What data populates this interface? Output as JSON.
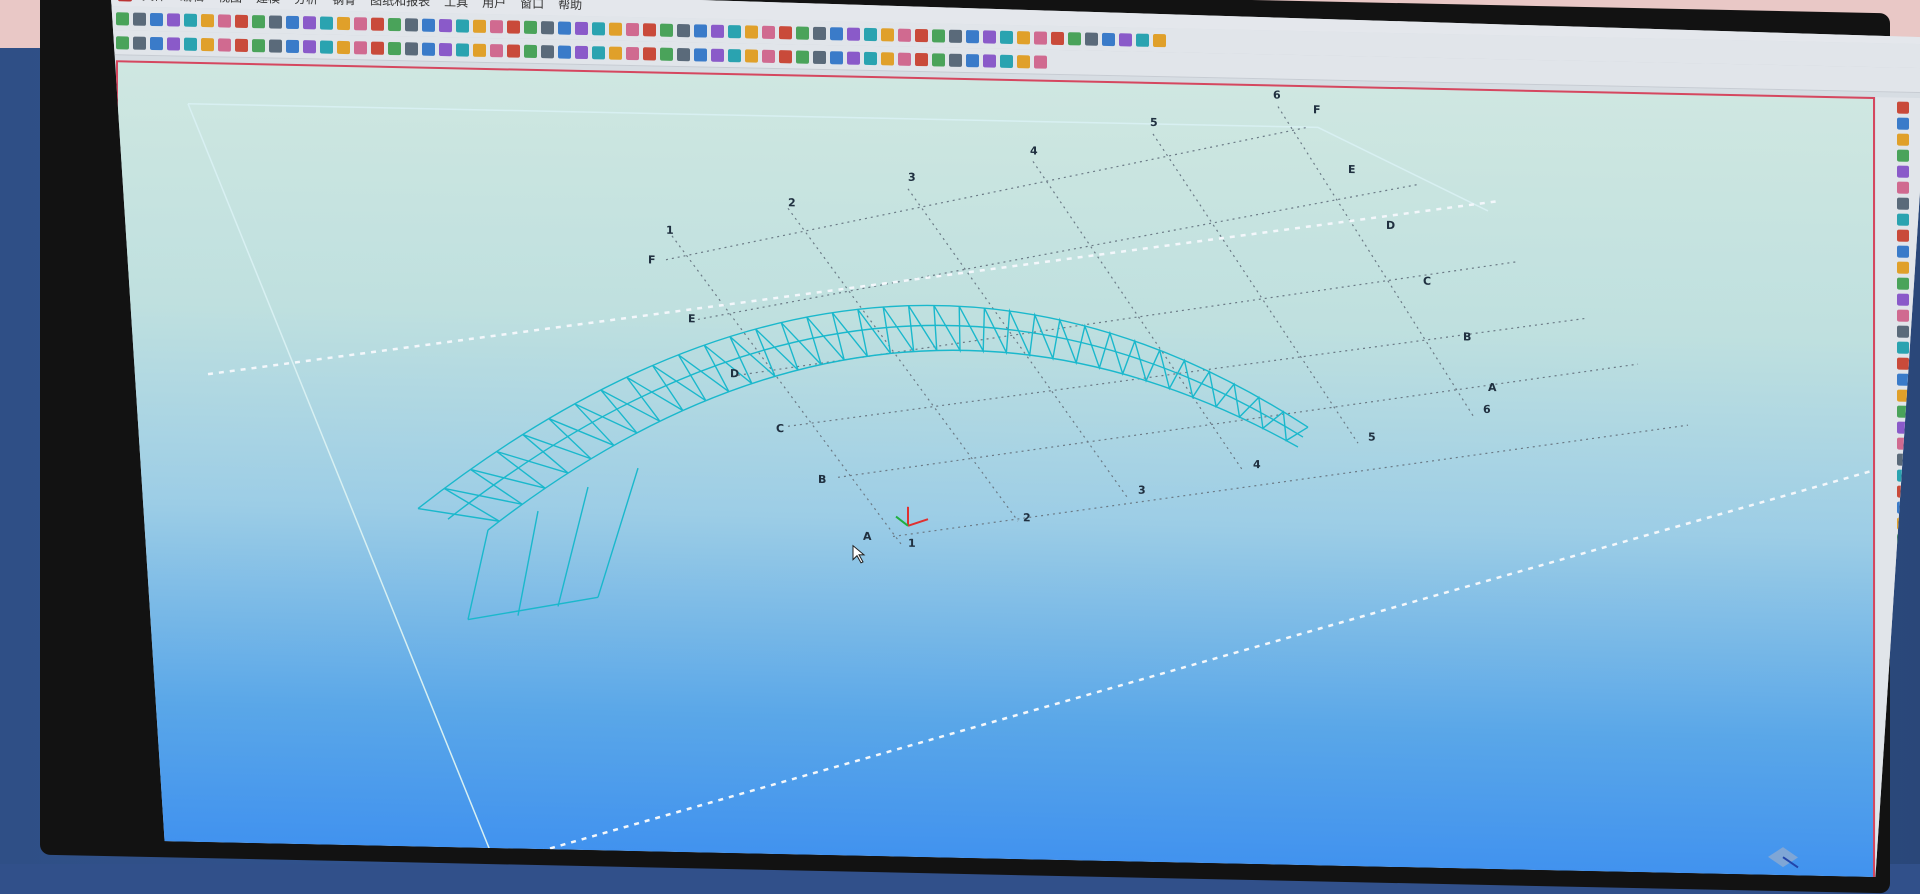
{
  "app": {
    "window_controls": [
      "▾",
      "—",
      "❐",
      "✕"
    ]
  },
  "menu": {
    "items": [
      "文件",
      "编辑",
      "视图",
      "建模",
      "分析",
      "钢骨",
      "图纸和报表",
      "工具",
      "用户",
      "窗口",
      "帮助"
    ]
  },
  "grid_labels": {
    "numbers_top": [
      "1",
      "2",
      "3",
      "4",
      "5",
      "6"
    ],
    "numbers_bottom": [
      "1",
      "2",
      "3",
      "4",
      "5",
      "6"
    ],
    "letters_left": [
      "A",
      "B",
      "C",
      "D",
      "E",
      "F"
    ],
    "letters_right": [
      "A",
      "B",
      "C",
      "D",
      "E",
      "F"
    ]
  },
  "colors": {
    "accent_frame": "#d5475f",
    "structure": "#1ab8cc",
    "grid": "#6b7a86"
  },
  "icons": [
    "app-icon",
    "axis-triad-icon",
    "view-cube-icon",
    "cursor-icon"
  ]
}
